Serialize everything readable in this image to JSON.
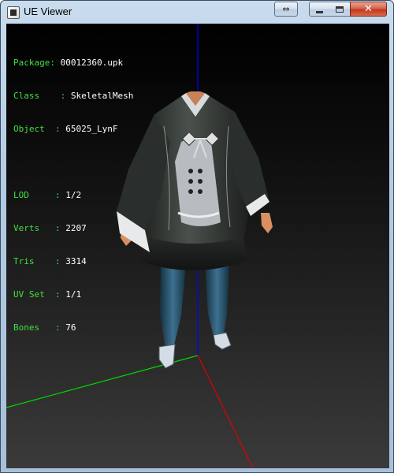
{
  "window": {
    "title": "UE Viewer",
    "resize_glyph": "⇔",
    "close_glyph": "✕"
  },
  "info": {
    "package": {
      "label": "Package",
      "value": "00012360.upk"
    },
    "class": {
      "label": "Class  ",
      "value": "SkeletalMesh"
    },
    "object": {
      "label": "Object ",
      "value": "65025_LynF"
    },
    "lod": {
      "label": "LOD    ",
      "value": "1/2"
    },
    "verts": {
      "label": "Verts  ",
      "value": "2207"
    },
    "tris": {
      "label": "Tris   ",
      "value": "3314"
    },
    "uvset": {
      "label": "UV Set ",
      "value": "1/1"
    },
    "bones": {
      "label": "Bones  ",
      "value": "76"
    }
  },
  "colors": {
    "label_green": "#3fe03f",
    "axis_x": "#ff0000",
    "axis_y": "#00ff00",
    "axis_z": "#0000ff"
  }
}
